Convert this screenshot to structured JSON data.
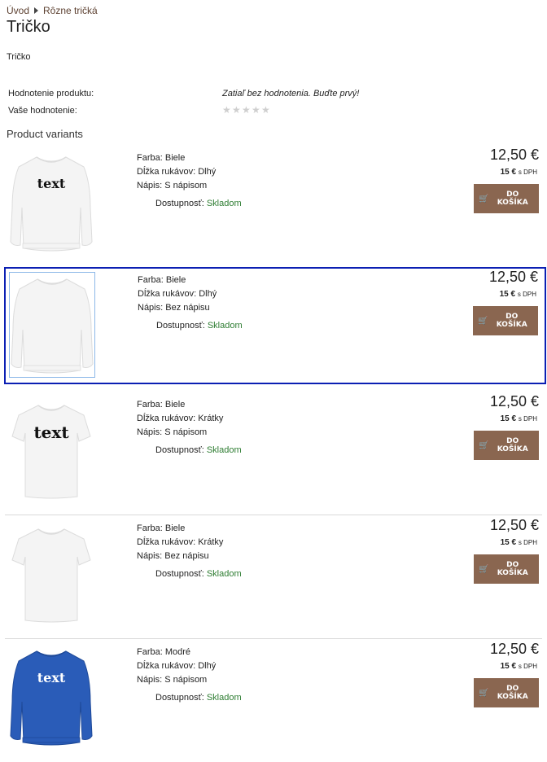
{
  "breadcrumb": [
    "Úvod",
    "Rôzne tričká"
  ],
  "title": "Tričko",
  "subtitle": "Tričko",
  "rating": {
    "product_label": "Hodnotenie produktu:",
    "product_value": "Zatiaľ bez hodnotenia. Buďte prvý!",
    "your_label": "Vaše hodnotenie:",
    "stars": 5
  },
  "variants_title": "Product variants",
  "labels": {
    "color": "Farba:",
    "sleeve": "Dĺžka rukávov:",
    "print": "Nápis:",
    "availability": "Dostupnosť:",
    "cart_button": "DO KOŠÍKA",
    "dph_suffix": "s DPH"
  },
  "variants": [
    {
      "color": "Biele",
      "sleeve": "Dlhý",
      "print": "S nápisom",
      "availability": "Skladom",
      "price": "12,50 €",
      "price_dph": "15 €",
      "image": "white-sweatshirt-text",
      "shirt_color": "#f4f4f4",
      "selected": false
    },
    {
      "color": "Biele",
      "sleeve": "Dlhý",
      "print": "Bez nápisu",
      "availability": "Skladom",
      "price": "12,50 €",
      "price_dph": "15 €",
      "image": "white-sweatshirt",
      "shirt_color": "#f4f4f4",
      "selected": true
    },
    {
      "color": "Biele",
      "sleeve": "Krátky",
      "print": "S nápisom",
      "availability": "Skladom",
      "price": "12,50 €",
      "price_dph": "15 €",
      "image": "white-tshirt-text",
      "shirt_color": "#f4f4f4",
      "selected": false
    },
    {
      "color": "Biele",
      "sleeve": "Krátky",
      "print": "Bez nápisu",
      "availability": "Skladom",
      "price": "12,50 €",
      "price_dph": "15 €",
      "image": "white-tshirt",
      "shirt_color": "#f4f4f4",
      "selected": false
    },
    {
      "color": "Modré",
      "sleeve": "Dlhý",
      "print": "S nápisom",
      "availability": "Skladom",
      "price": "12,50 €",
      "price_dph": "15 €",
      "image": "blue-sweatshirt-text",
      "shirt_color": "#2a5cb8",
      "selected": false
    }
  ],
  "print_text": "text",
  "colors": {
    "accent_button": "#8a6650",
    "stock": "#2e7d32",
    "selection": "#0b1fb3"
  }
}
